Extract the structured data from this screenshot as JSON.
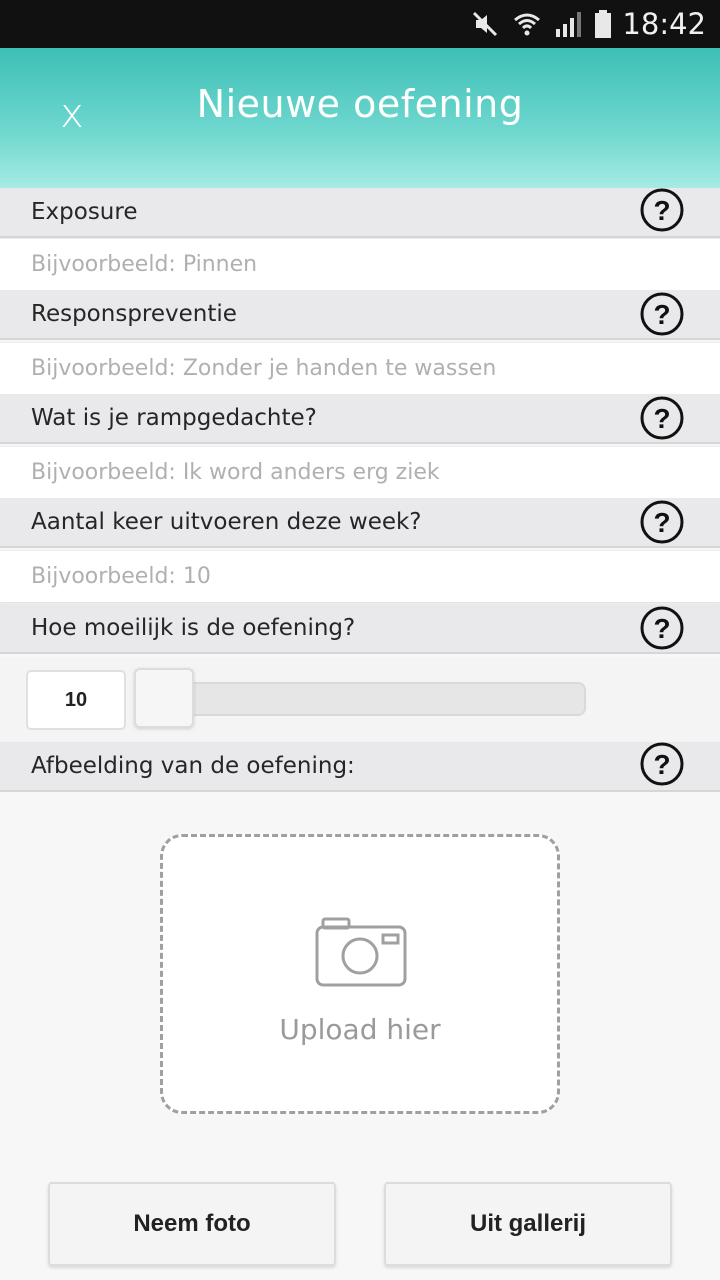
{
  "status_bar": {
    "time": "18:42",
    "icons": [
      "mute-icon",
      "wifi-icon",
      "signal-icon",
      "battery-icon"
    ]
  },
  "app_bar": {
    "close_label": "x",
    "title": "Nieuwe oefening",
    "gradient_colors": [
      "#3dbfb6",
      "#a6ebe4"
    ]
  },
  "form": {
    "sections": [
      {
        "label": "Exposure",
        "placeholder": "Bijvoorbeeld: Pinnen"
      },
      {
        "label": "Responspreventie",
        "placeholder": "Bijvoorbeeld: Zonder je handen te wassen"
      },
      {
        "label": "Wat is je rampgedachte?",
        "placeholder": "Bijvoorbeeld: Ik word anders erg ziek"
      },
      {
        "label": "Aantal keer uitvoeren deze week?",
        "placeholder": "Bijvoorbeeld: 10"
      },
      {
        "label": "Hoe moeilijk is de oefening?"
      },
      {
        "label": "Afbeelding van de oefening:"
      }
    ],
    "difficulty": {
      "value": "10",
      "slider_fraction": 0
    }
  },
  "upload": {
    "label": "Upload hier",
    "icon": "camera-icon"
  },
  "buttons": {
    "take_photo": "Neem foto",
    "from_gallery": "Uit gallerij"
  }
}
